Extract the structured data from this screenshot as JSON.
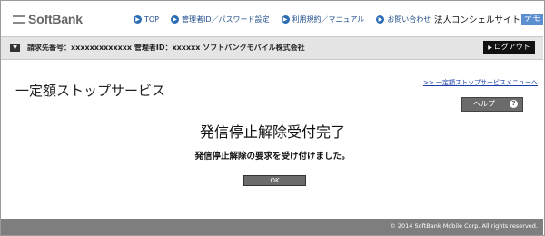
{
  "brand": {
    "name": "SoftBank",
    "icon": "softbank-logo-icon"
  },
  "nav": {
    "items": [
      {
        "label": "TOP",
        "icon": "arrow-circle-icon"
      },
      {
        "label": "管理者ID／パスワード設定",
        "icon": "arrow-circle-icon"
      },
      {
        "label": "利用規約／マニュアル",
        "icon": "arrow-circle-icon"
      },
      {
        "label": "お問い合わせ",
        "icon": "arrow-circle-icon"
      }
    ],
    "corp_site": "法人コンシェルサイト",
    "demo_badge": "デモ"
  },
  "infobar": {
    "text": "請求先番号：xxxxxxxxxxxxx 管理者ID：xxxxxx ソフトバンクモバイル株式会社",
    "logout_label": "ログアウト"
  },
  "main": {
    "page_title": "一定額ストップサービス",
    "menu_link": ">> 一定額ストップサービスメニューへ",
    "help_label": "ヘルプ",
    "help_icon_glyph": "?",
    "done_title": "発信停止解除受付完了",
    "done_message": "発信停止解除の要求を受け付けました。",
    "ok_label": "OK"
  },
  "footer": {
    "copyright": "© 2014 SoftBank Mobile Corp. All rights reserved."
  },
  "colors": {
    "nav_link": "#1f4e8a",
    "demo_badge": "#5b8fd0",
    "infobar": "#e5e5e5",
    "footer": "#7e7e7e"
  }
}
